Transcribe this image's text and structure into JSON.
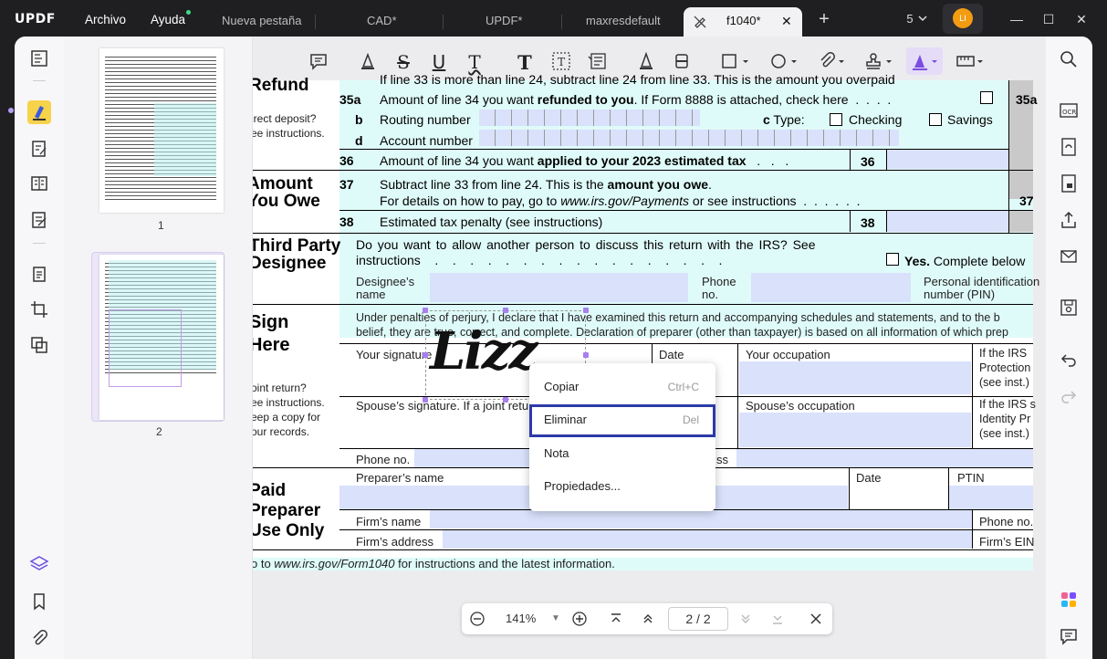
{
  "app": {
    "logo": "UPDF",
    "menus": [
      "Archivo",
      "Ayuda"
    ]
  },
  "tabs": [
    {
      "label": "Nueva pestaña"
    },
    {
      "label": "CAD*"
    },
    {
      "label": "UPDF*"
    },
    {
      "label": "maxresdefault"
    },
    {
      "label": "f1040*",
      "active": true
    }
  ],
  "window": {
    "tab_count": "5",
    "avatar": "LI"
  },
  "thumbnails": [
    {
      "num": "1"
    },
    {
      "num": "2",
      "selected": true
    }
  ],
  "doc": {
    "refund_head": "Refund",
    "line35a_num": "35a",
    "line35a": "Amount of line 34 you want ",
    "line35a_b": "refunded to you",
    "line35a_c": ". If Form 8888 is attached, check here",
    "top_cut": "If line 33 is more than line 24, subtract line 24 from line 33. This is the amount you overpaid",
    "direct1": "irect deposit?",
    "direct2": "ee instructions.",
    "b": "b",
    "routing": "Routing number",
    "ctype": "c Type:",
    "checking": "Checking",
    "savings": "Savings",
    "d": "d",
    "account": "Account number",
    "n36": "36",
    "l36a": "Amount of line 34 you want ",
    "l36b": "applied to your 2023 estimated tax",
    "n36b": "36",
    "owe_head1": "Amount",
    "owe_head2": "You Owe",
    "n37": "37",
    "l37a": "Subtract line 33 from line 24. This is the ",
    "l37b": "amount you owe",
    "l37c": "For details on how to pay, go to ",
    "l37d": "www.irs.gov/Payments",
    " l37e": " or see instructions",
    "n38": "38",
    "l38": "Estimated tax penalty (see instructions)",
    "n38b": "38",
    "n37r": "37",
    "n35r": "35a",
    "tp_head1": "Third Party",
    "tp_head2": "Designee",
    "tp_q": "Do you want to allow another person to discuss this return with the IRS? See",
    "tp_q2": "instructions",
    "yes": "Yes.",
    "yes2": " Complete below",
    "designee": "Designee’s",
    "designee2": "name",
    "phone": "Phone",
    "phone2": "no.",
    "pin": "Personal identification",
    "pin2": "number (PIN)",
    "sign1": "Sign",
    "sign2": "Here",
    "perjury1": "Under penalties of perjury, I declare that I have examined this return and accompanying schedules and statements, and to the b",
    "perjury2": "belief, they are true, correct, and complete. Declaration of preparer (other than taxpayer) is based on all information of which prep",
    "your_sig": "Your signature",
    "date": "Date",
    "your_occ": "Your occupation",
    "irs1": "If the IRS",
    "irs2": "Protection",
    "irs3": "(see inst.)",
    "joint1": "oint return?",
    "joint2": "ee instructions.",
    "joint3": "eep a copy for",
    "joint4": "our records.",
    "spouse_sig": "Spouse’s signature. If a joint retu",
    "spouse_occ": "Spouse’s occupation",
    "irs4": "If the IRS s",
    "irs5": "Identity Pr",
    "irs6": "(see inst.)",
    "phone_no": "Phone no.",
    "ss": "ss",
    "paid1": "Paid",
    "paid2": "Preparer",
    "paid3": "Use Only",
    "prep_name": "Preparer’s name",
    "date2": "Date",
    "ptin": "PTIN",
    "firm_name": "Firm’s name",
    "phone_no2": "Phone no.",
    "firm_addr": "Firm’s address",
    "firm_ein": "Firm’s EIN",
    "footer1": "o to ",
    "footer2": "www.irs.gov/Form1040",
    "footer3": " for instructions and the latest information.",
    "signature": "Lizz"
  },
  "context_menu": [
    {
      "label": "Copiar",
      "shortcut": "Ctrl+C"
    },
    {
      "label": "Eliminar",
      "shortcut": "Del",
      "selected": true
    },
    {
      "label": "Nota",
      "shortcut": ""
    },
    {
      "label": "Propiedades...",
      "shortcut": ""
    }
  ],
  "nav": {
    "zoom": "141%",
    "page_current": "2",
    "page_sep": "/",
    "page_total": "2"
  },
  "colors": {
    "accent": "#a87ef0",
    "highlight_border": "#2c3aa8",
    "field": "#d9e1fb",
    "cyan": "#dffbf9"
  }
}
